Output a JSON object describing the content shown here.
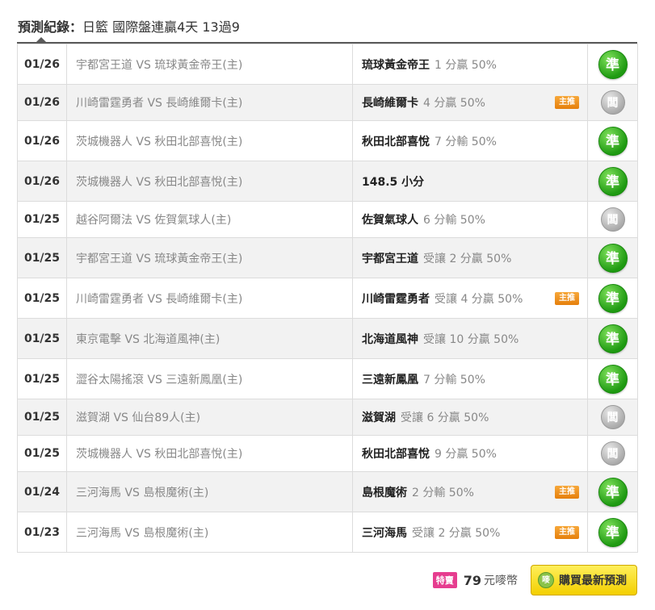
{
  "header": {
    "label": "預測紀錄：",
    "summary": "日籃 國際盤連贏4天 13過9"
  },
  "records": [
    {
      "date": "01/26",
      "match": "宇都宮王道 VS 琉球黃金帝王(主)",
      "pick": "琉球黃金帝王",
      "detail": "1 分贏 50%",
      "tag": "",
      "result": "準",
      "status": "win"
    },
    {
      "date": "01/26",
      "match": "川崎雷霆勇者 VS 長崎維爾卡(主)",
      "pick": "長崎維爾卡",
      "detail": "4 分贏 50%",
      "tag": "主推",
      "result": "闆",
      "status": "push"
    },
    {
      "date": "01/26",
      "match": "茨城機器人 VS 秋田北部喜悅(主)",
      "pick": "秋田北部喜悅",
      "detail": "7 分輸 50%",
      "tag": "",
      "result": "準",
      "status": "win"
    },
    {
      "date": "01/26",
      "match": "茨城機器人 VS 秋田北部喜悅(主)",
      "pick": "148.5 小分",
      "detail": "",
      "tag": "",
      "result": "準",
      "status": "win"
    },
    {
      "date": "01/25",
      "match": "越谷阿爾法 VS 佐賀氣球人(主)",
      "pick": "佐賀氣球人",
      "detail": "6 分輸 50%",
      "tag": "",
      "result": "闆",
      "status": "push"
    },
    {
      "date": "01/25",
      "match": "宇都宮王道 VS 琉球黃金帝王(主)",
      "pick": "宇都宮王道",
      "detail": "受讓 2 分贏 50%",
      "tag": "",
      "result": "準",
      "status": "win"
    },
    {
      "date": "01/25",
      "match": "川崎雷霆勇者 VS 長崎維爾卡(主)",
      "pick": "川崎雷霆勇者",
      "detail": "受讓 4 分贏 50%",
      "tag": "主推",
      "result": "準",
      "status": "win"
    },
    {
      "date": "01/25",
      "match": "東京電擊 VS 北海道風神(主)",
      "pick": "北海道風神",
      "detail": "受讓 10 分贏 50%",
      "tag": "",
      "result": "準",
      "status": "win"
    },
    {
      "date": "01/25",
      "match": "澀谷太陽搖滾 VS 三遠新鳳凰(主)",
      "pick": "三遠新鳳凰",
      "detail": "7 分輸 50%",
      "tag": "",
      "result": "準",
      "status": "win"
    },
    {
      "date": "01/25",
      "match": "滋賀湖 VS 仙台89人(主)",
      "pick": "滋賀湖",
      "detail": "受讓 6 分贏 50%",
      "tag": "",
      "result": "闆",
      "status": "push"
    },
    {
      "date": "01/25",
      "match": "茨城機器人 VS 秋田北部喜悅(主)",
      "pick": "秋田北部喜悅",
      "detail": "9 分贏 50%",
      "tag": "",
      "result": "闆",
      "status": "push"
    },
    {
      "date": "01/24",
      "match": "三河海馬 VS 島根魔術(主)",
      "pick": "島根魔術",
      "detail": "2 分輸 50%",
      "tag": "主推",
      "result": "準",
      "status": "win"
    },
    {
      "date": "01/23",
      "match": "三河海馬 VS 島根魔術(主)",
      "pick": "三河海馬",
      "detail": "受讓 2 分贏 50%",
      "tag": "主推",
      "result": "準",
      "status": "win"
    }
  ],
  "footer": {
    "special_label": "特賣",
    "price": "79",
    "unit": "元嘜幣",
    "buy_icon": "嘜",
    "buy_label": "購買最新預測"
  }
}
